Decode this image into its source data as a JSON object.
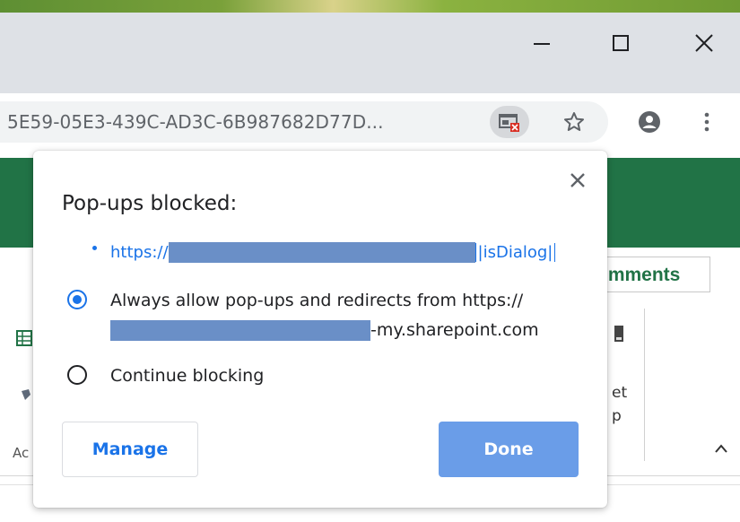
{
  "browser": {
    "url": "5E59-05E3-439C-AD3C-6B987682D77D...",
    "window_controls": {
      "minimize": "—",
      "maximize": "☐",
      "close": "✕"
    }
  },
  "background_app": {
    "brand_color": "#217346",
    "comments_label": "omments",
    "ribbon_fragments": [
      "Ac",
      "et",
      "p"
    ]
  },
  "dialog": {
    "title": "Pop-ups blocked:",
    "blocked_item": {
      "prefix": "https://",
      "suffix": "|isDialog|"
    },
    "options": [
      {
        "line1": "Always allow pop-ups and redirects from https://",
        "line2_suffix": "-my.sharepoint.com",
        "selected": true
      },
      {
        "line1": "Continue blocking",
        "selected": false
      }
    ],
    "manage_label": "Manage",
    "done_label": "Done"
  },
  "colors": {
    "accent": "#1a73e8",
    "done_button": "#6a9de8",
    "redaction": "#6a8fc7"
  }
}
